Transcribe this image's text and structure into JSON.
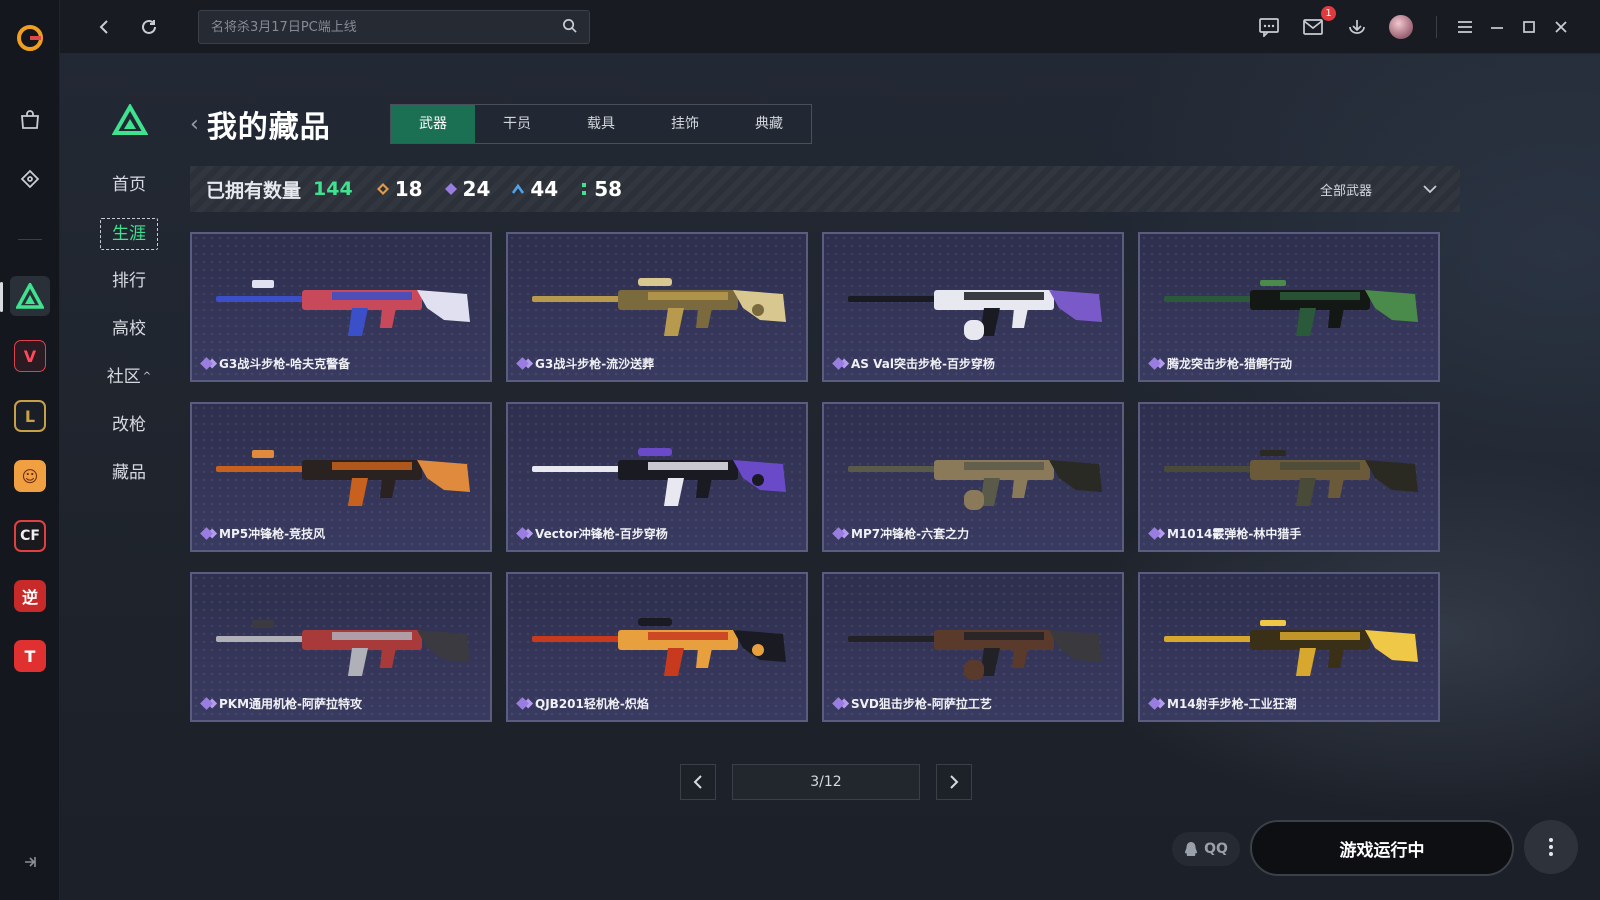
{
  "topbar": {
    "search_placeholder": "名将杀3月17日PC端上线",
    "mail_badge": "1"
  },
  "subnav": {
    "items": [
      "首页",
      "生涯",
      "排行",
      "高校",
      "社区",
      "改枪",
      "藏品"
    ],
    "active": "生涯"
  },
  "header": {
    "title": "我的藏品",
    "tabs": [
      "武器",
      "干员",
      "载具",
      "挂饰",
      "典藏"
    ],
    "active_tab": "武器"
  },
  "stats": {
    "label": "已拥有数量",
    "total": "144",
    "rarities": [
      {
        "icon": "orange-diamond-icon",
        "count": "18",
        "color": "#e09a4a"
      },
      {
        "icon": "purple-diamond-icon",
        "count": "24",
        "color": "#9a7de0"
      },
      {
        "icon": "blue-chevron-icon",
        "count": "44",
        "color": "#4fa3e8"
      },
      {
        "icon": "green-dots-icon",
        "count": "58",
        "color": "#3ee28f"
      }
    ],
    "filter_label": "全部武器"
  },
  "items": [
    {
      "name": "G3战斗步枪-哈夫克警备",
      "palette": [
        "#3a4fc8",
        "#c84a5a",
        "#e0e0f0"
      ]
    },
    {
      "name": "G3战斗步枪-流沙送葬",
      "palette": [
        "#b89a4e",
        "#7a6a3e",
        "#d8c890"
      ]
    },
    {
      "name": "AS Val突击步枪-百步穿杨",
      "palette": [
        "#1a1a22",
        "#e8e8f0",
        "#7a5ac8"
      ]
    },
    {
      "name": "腾龙突击步枪-猎鳄行动",
      "palette": [
        "#2a5a3a",
        "#141814",
        "#4a8a4a"
      ]
    },
    {
      "name": "MP5冲锋枪-竞技风",
      "palette": [
        "#c8601e",
        "#2a2220",
        "#e08a3e"
      ]
    },
    {
      "name": "Vector冲锋枪-百步穿杨",
      "palette": [
        "#e8e8f0",
        "#1a1a22",
        "#6a4ac8"
      ]
    },
    {
      "name": "MP7冲锋枪-六套之力",
      "palette": [
        "#5a5a4a",
        "#8a7a5a",
        "#2a2a24"
      ]
    },
    {
      "name": "M1014霰弹枪-林中猎手",
      "palette": [
        "#4a4a38",
        "#6a5a3a",
        "#2a2a22"
      ]
    },
    {
      "name": "PKM通用机枪-阿萨拉特攻",
      "palette": [
        "#b0b0b8",
        "#a83a3a",
        "#3a3a40"
      ]
    },
    {
      "name": "QJB201轻机枪-炽焰",
      "palette": [
        "#c83a1e",
        "#e8a03e",
        "#1a1a22"
      ]
    },
    {
      "name": "SVD狙击步枪-阿萨拉工艺",
      "palette": [
        "#222226",
        "#5a3a2a",
        "#3a3a3e"
      ]
    },
    {
      "name": "M14射手步枪-工业狂潮",
      "palette": [
        "#d8a82e",
        "#3a3018",
        "#f0c848"
      ]
    }
  ],
  "pagination": {
    "indicator": "3/12"
  },
  "bottom": {
    "qq_label": "QQ",
    "play_label": "游戏运行中"
  }
}
